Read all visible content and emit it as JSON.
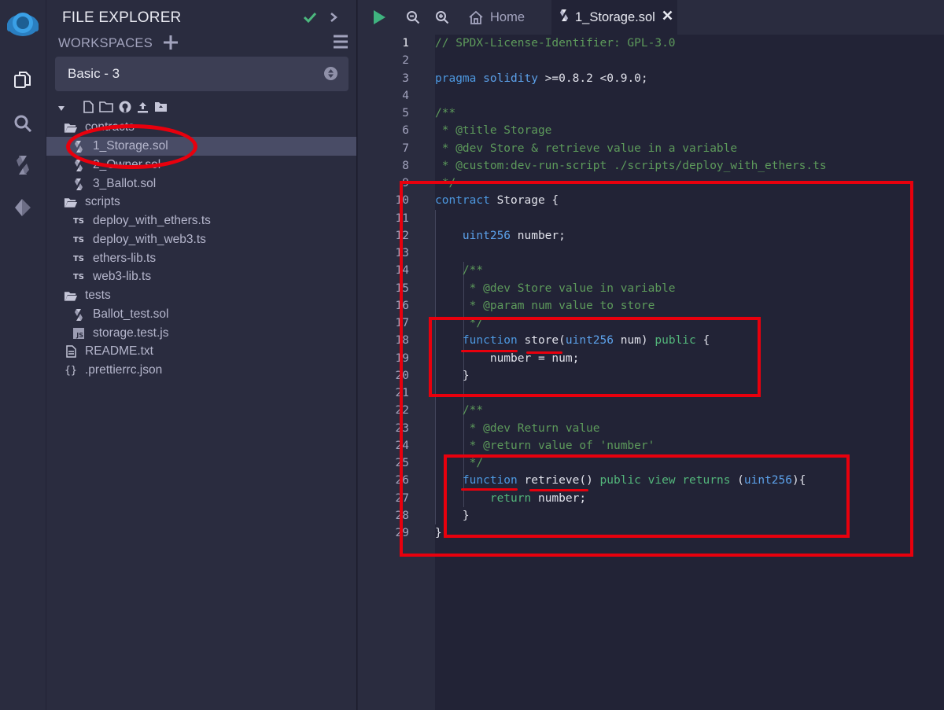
{
  "sidebar_icons": [
    "remix-logo-icon",
    "file-explorer-icon",
    "search-icon",
    "solidity-compiler-icon",
    "deploy-run-icon"
  ],
  "explorer": {
    "title": "FILE EXPLORER",
    "workspaces_label": "WORKSPACES",
    "workspace_selected": "Basic - 3",
    "files": [
      {
        "name": "contracts",
        "type": "folder"
      },
      {
        "name": "1_Storage.sol",
        "type": "sol",
        "selected": true
      },
      {
        "name": "2_Owner.sol",
        "type": "sol"
      },
      {
        "name": "3_Ballot.sol",
        "type": "sol"
      },
      {
        "name": "scripts",
        "type": "folder"
      },
      {
        "name": "deploy_with_ethers.ts",
        "type": "ts"
      },
      {
        "name": "deploy_with_web3.ts",
        "type": "ts"
      },
      {
        "name": "ethers-lib.ts",
        "type": "ts"
      },
      {
        "name": "web3-lib.ts",
        "type": "ts"
      },
      {
        "name": "tests",
        "type": "folder"
      },
      {
        "name": "Ballot_test.sol",
        "type": "sol"
      },
      {
        "name": "storage.test.js",
        "type": "js"
      },
      {
        "name": "README.txt",
        "type": "txt"
      },
      {
        "name": ".prettierrc.json",
        "type": "json"
      }
    ]
  },
  "tabs": {
    "home_label": "Home",
    "active_label": "1_Storage.sol"
  },
  "editor": {
    "active_line": 1,
    "lines": [
      [
        [
          "// SPDX-License-Identifier: GPL-3.0",
          "com"
        ]
      ],
      [],
      [
        [
          "pragma",
          "kw"
        ],
        [
          " ",
          "plain"
        ],
        [
          "solidity",
          "type"
        ],
        [
          " >=0.8.2 <0.9.0;",
          "plain"
        ]
      ],
      [],
      [
        [
          "/**",
          "com"
        ]
      ],
      [
        [
          " * @title Storage",
          "com"
        ]
      ],
      [
        [
          " * @dev Store & retrieve value in a variable",
          "com"
        ]
      ],
      [
        [
          " * @custom:dev-run-script ./scripts/deploy_with_ethers.ts",
          "com"
        ]
      ],
      [
        [
          " */",
          "com"
        ]
      ],
      [
        [
          "contract",
          "kw"
        ],
        [
          " Storage {",
          "plain"
        ]
      ],
      [],
      [
        [
          "    ",
          "plain"
        ],
        [
          "uint256",
          "type"
        ],
        [
          " number;",
          "plain"
        ]
      ],
      [],
      [
        [
          "    /**",
          "com"
        ]
      ],
      [
        [
          "     * @dev Store value in variable",
          "com"
        ]
      ],
      [
        [
          "     * @param num value to store",
          "com"
        ]
      ],
      [
        [
          "     */",
          "com"
        ]
      ],
      [
        [
          "    ",
          "plain"
        ],
        [
          "function",
          "kw"
        ],
        [
          " store(",
          "plain"
        ],
        [
          "uint256",
          "type"
        ],
        [
          " num) ",
          "plain"
        ],
        [
          "public",
          "grn"
        ],
        [
          " {",
          "plain"
        ]
      ],
      [
        [
          "        number = num;",
          "plain"
        ]
      ],
      [
        [
          "    }",
          "plain"
        ]
      ],
      [],
      [
        [
          "    /**",
          "com"
        ]
      ],
      [
        [
          "     * @dev Return value",
          "com"
        ]
      ],
      [
        [
          "     * @return value of 'number'",
          "com"
        ]
      ],
      [
        [
          "     */",
          "com"
        ]
      ],
      [
        [
          "    ",
          "plain"
        ],
        [
          "function",
          "kw"
        ],
        [
          " retrieve() ",
          "plain"
        ],
        [
          "public",
          "grn"
        ],
        [
          " ",
          "plain"
        ],
        [
          "view",
          "grn"
        ],
        [
          " ",
          "plain"
        ],
        [
          "returns",
          "grn"
        ],
        [
          " (",
          "plain"
        ],
        [
          "uint256",
          "type"
        ],
        [
          "){",
          "plain"
        ]
      ],
      [
        [
          "        ",
          "plain"
        ],
        [
          "return",
          "grn"
        ],
        [
          " number;",
          "plain"
        ]
      ],
      [
        [
          "    }",
          "plain"
        ]
      ],
      [
        [
          "}",
          "plain"
        ]
      ]
    ]
  },
  "colors": {
    "annotation": "#e8000d",
    "keyword": "#4d98e0",
    "comment": "#5d9a5b",
    "check": "#4cb87e",
    "run": "#3fb37f"
  }
}
